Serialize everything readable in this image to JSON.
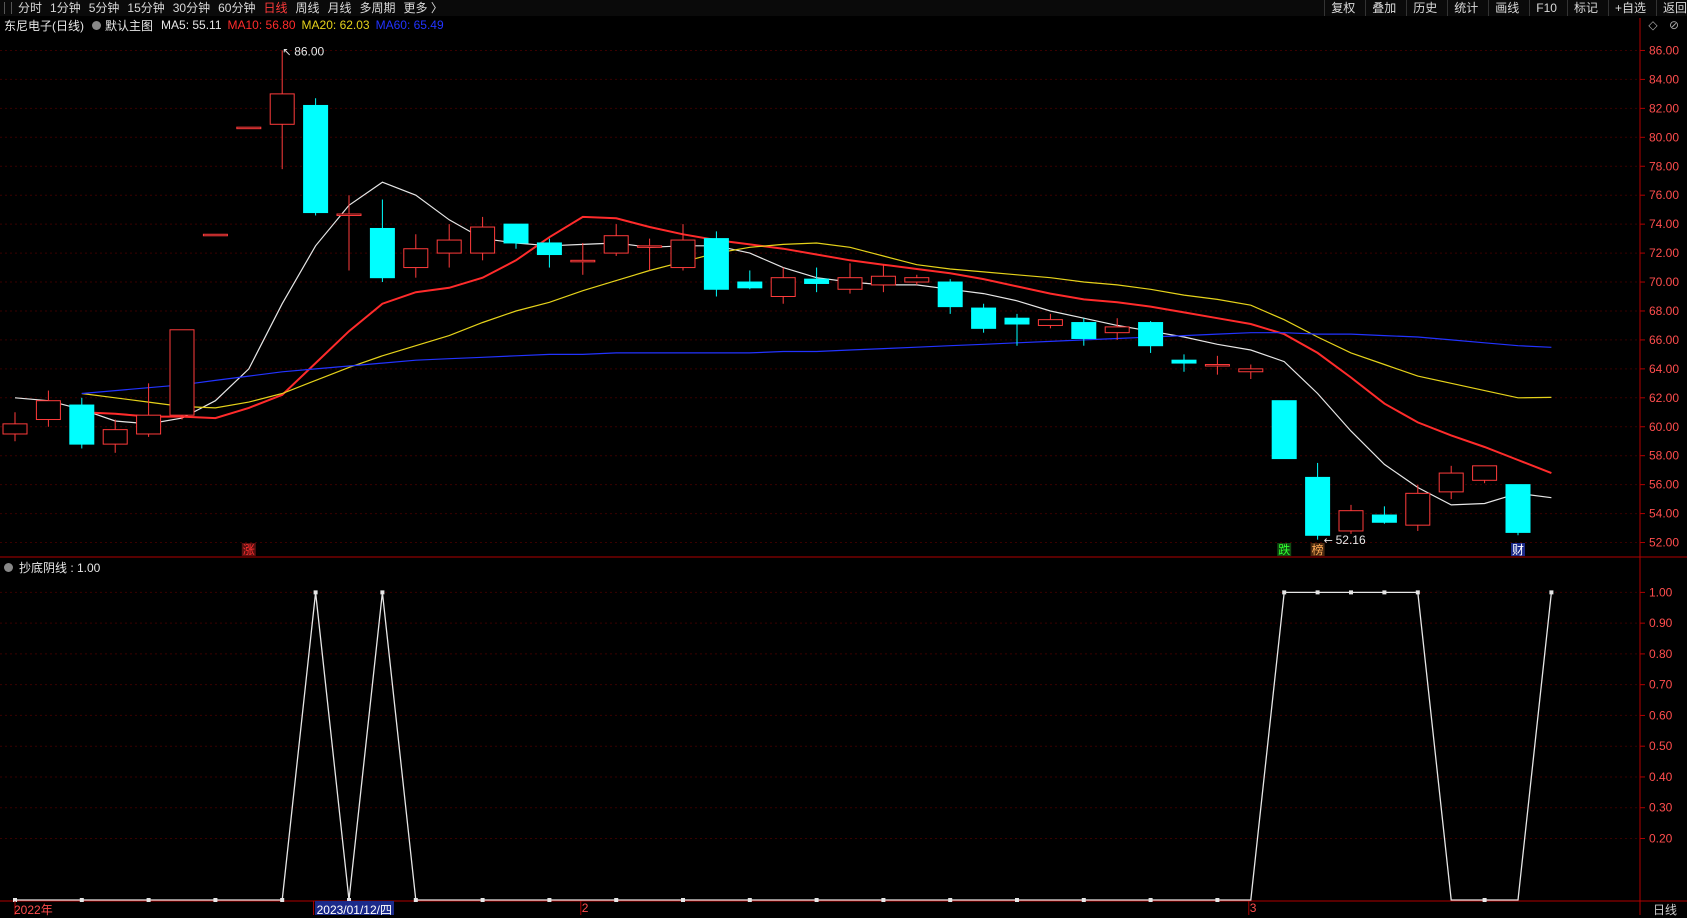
{
  "toolbar": {
    "periods": [
      "分时",
      "1分钟",
      "5分钟",
      "15分钟",
      "30分钟",
      "60分钟",
      "日线",
      "周线",
      "月线",
      "多周期",
      "更多 〉"
    ],
    "active_index": 6,
    "right": [
      "复权",
      "叠加",
      "历史",
      "统计",
      "画线",
      "F10",
      "标记",
      "+自选",
      "返回"
    ]
  },
  "main_legend": {
    "ticker": "东尼电子(日线)",
    "chart_name": "默认主图",
    "ma": [
      {
        "label": "MA5: 55.11",
        "color": "#e6e6e6"
      },
      {
        "label": "MA10: 56.80",
        "color": "#ff2b2b"
      },
      {
        "label": "MA20: 62.03",
        "color": "#e5d21a"
      },
      {
        "label": "MA60: 65.49",
        "color": "#2233ff"
      }
    ]
  },
  "corner_icons": "◇ ⊘",
  "annotations": {
    "high": "86.00",
    "low": "52.16",
    "low_arrow": "←",
    "high_arrow": "↖"
  },
  "markers": [
    {
      "text": "涨",
      "color": "#ff3030",
      "bg": "#5a1010",
      "idx": 7
    },
    {
      "text": "跌",
      "color": "#30ff30",
      "bg": "#104a10",
      "idx": 38
    },
    {
      "text": "榜",
      "color": "#ffaa55",
      "bg": "#4a2a10",
      "idx": 39
    },
    {
      "text": "财",
      "color": "#ffffff",
      "bg": "#1b2a8a",
      "idx": 45
    }
  ],
  "indicator_legend": "抄底阴线 : 1.00",
  "day_label": "日线",
  "dates": [
    {
      "text": "2022年",
      "idx": 0,
      "selected": false
    },
    {
      "text": "2023/01/12/四",
      "idx": 9,
      "selected": true
    },
    {
      "text": "2",
      "idx": 17,
      "selected": false
    },
    {
      "text": "3",
      "idx": 37,
      "selected": false
    }
  ],
  "chart_data": [
    {
      "type": "candlestick",
      "title": "东尼电子(日线)",
      "ylim": [
        51,
        87
      ],
      "y_ticks": [
        "86.00",
        "84.00",
        "82.00",
        "80.00",
        "78.00",
        "76.00",
        "74.00",
        "72.00",
        "70.00",
        "68.00",
        "66.00",
        "64.00",
        "62.00",
        "60.00",
        "58.00",
        "56.00",
        "54.00",
        "52.00"
      ],
      "candles": [
        {
          "o": 59.5,
          "c": 60.2,
          "h": 61.0,
          "l": 59.0
        },
        {
          "o": 60.5,
          "c": 61.8,
          "h": 62.5,
          "l": 60.0
        },
        {
          "o": 61.5,
          "c": 58.8,
          "h": 62.0,
          "l": 58.5
        },
        {
          "o": 58.8,
          "c": 59.8,
          "h": 60.5,
          "l": 58.2
        },
        {
          "o": 59.5,
          "c": 60.8,
          "h": 63.0,
          "l": 59.3
        },
        {
          "o": 60.8,
          "c": 66.7,
          "h": 66.7,
          "l": 60.5
        },
        {
          "o": 73.3,
          "c": 73.3,
          "h": 73.3,
          "l": 73.3
        },
        {
          "o": 80.7,
          "c": 80.7,
          "h": 80.7,
          "l": 80.7
        },
        {
          "o": 80.9,
          "c": 83.0,
          "h": 86.0,
          "l": 77.8
        },
        {
          "o": 82.2,
          "c": 74.8,
          "h": 82.7,
          "l": 74.6
        },
        {
          "o": 74.7,
          "c": 74.7,
          "h": 76.0,
          "l": 70.8
        },
        {
          "o": 73.7,
          "c": 70.3,
          "h": 75.7,
          "l": 70.0
        },
        {
          "o": 71.0,
          "c": 72.3,
          "h": 73.3,
          "l": 70.3
        },
        {
          "o": 72.0,
          "c": 72.9,
          "h": 74.0,
          "l": 71.0
        },
        {
          "o": 72.0,
          "c": 73.8,
          "h": 74.5,
          "l": 71.5
        },
        {
          "o": 74.0,
          "c": 72.7,
          "h": 74.0,
          "l": 72.3
        },
        {
          "o": 72.7,
          "c": 71.9,
          "h": 73.0,
          "l": 71.0
        },
        {
          "o": 71.5,
          "c": 71.5,
          "h": 72.7,
          "l": 70.5
        },
        {
          "o": 72.0,
          "c": 73.2,
          "h": 74.0,
          "l": 71.8
        },
        {
          "o": 72.5,
          "c": 72.5,
          "h": 73.0,
          "l": 70.8
        },
        {
          "o": 71.0,
          "c": 72.9,
          "h": 74.0,
          "l": 70.8
        },
        {
          "o": 73.0,
          "c": 69.5,
          "h": 73.5,
          "l": 69.0
        },
        {
          "o": 70.0,
          "c": 69.6,
          "h": 70.8,
          "l": 69.5
        },
        {
          "o": 69.0,
          "c": 70.3,
          "h": 71.0,
          "l": 68.5
        },
        {
          "o": 70.2,
          "c": 69.9,
          "h": 71.0,
          "l": 69.3
        },
        {
          "o": 69.5,
          "c": 70.3,
          "h": 71.3,
          "l": 69.2
        },
        {
          "o": 69.8,
          "c": 70.4,
          "h": 71.2,
          "l": 69.3
        },
        {
          "o": 70.0,
          "c": 70.3,
          "h": 70.5,
          "l": 69.8
        },
        {
          "o": 70.0,
          "c": 68.3,
          "h": 70.2,
          "l": 67.8
        },
        {
          "o": 68.2,
          "c": 66.8,
          "h": 68.5,
          "l": 66.5
        },
        {
          "o": 67.5,
          "c": 67.1,
          "h": 67.8,
          "l": 65.6
        },
        {
          "o": 67.0,
          "c": 67.4,
          "h": 67.8,
          "l": 66.8
        },
        {
          "o": 67.2,
          "c": 66.1,
          "h": 67.5,
          "l": 65.6
        },
        {
          "o": 66.5,
          "c": 66.9,
          "h": 67.5,
          "l": 66.0
        },
        {
          "o": 67.2,
          "c": 65.6,
          "h": 67.3,
          "l": 65.1
        },
        {
          "o": 64.6,
          "c": 64.4,
          "h": 65.0,
          "l": 63.8
        },
        {
          "o": 64.2,
          "c": 64.3,
          "h": 64.9,
          "l": 63.6
        },
        {
          "o": 63.8,
          "c": 64.0,
          "h": 64.3,
          "l": 63.3
        },
        {
          "o": 61.8,
          "c": 57.8,
          "h": 61.8,
          "l": 57.8
        },
        {
          "o": 56.5,
          "c": 52.5,
          "h": 57.5,
          "l": 52.2
        },
        {
          "o": 52.8,
          "c": 54.2,
          "h": 54.6,
          "l": 52.6
        },
        {
          "o": 53.9,
          "c": 53.4,
          "h": 54.5,
          "l": 53.3
        },
        {
          "o": 53.2,
          "c": 55.4,
          "h": 56.0,
          "l": 52.8
        },
        {
          "o": 55.5,
          "c": 56.8,
          "h": 57.3,
          "l": 55.0
        },
        {
          "o": 56.3,
          "c": 57.3,
          "h": 57.3,
          "l": 56.1
        },
        {
          "o": 56.0,
          "c": 52.7,
          "h": 56.0,
          "l": 52.5
        }
      ],
      "series": [
        {
          "name": "MA5",
          "color": "#e6e6e6",
          "values": [
            62.0,
            61.8,
            61.2,
            60.4,
            60.2,
            60.6,
            61.8,
            64.0,
            68.5,
            72.5,
            75.3,
            76.9,
            76.0,
            74.3,
            73.0,
            72.7,
            72.5,
            72.6,
            72.7,
            72.4,
            72.5,
            72.5,
            72.0,
            71.0,
            70.3,
            70.0,
            69.8,
            69.8,
            69.5,
            69.2,
            68.7,
            68.0,
            67.5,
            67.0,
            66.6,
            66.2,
            65.7,
            65.3,
            64.5,
            62.3,
            59.7,
            57.4,
            55.8,
            54.6,
            54.7,
            55.4,
            55.1
          ]
        },
        {
          "name": "MA10",
          "color": "#ff2b2b",
          "values": [
            null,
            null,
            61.0,
            60.9,
            60.7,
            60.7,
            60.6,
            61.3,
            62.2,
            64.4,
            66.6,
            68.5,
            69.3,
            69.6,
            70.3,
            71.5,
            73.1,
            74.5,
            74.4,
            73.8,
            73.3,
            72.9,
            72.6,
            72.3,
            71.9,
            71.5,
            71.2,
            70.9,
            70.6,
            70.2,
            69.7,
            69.2,
            68.8,
            68.6,
            68.3,
            67.9,
            67.5,
            67.1,
            66.4,
            65.1,
            63.4,
            61.6,
            60.3,
            59.4,
            58.6,
            57.7,
            56.8
          ]
        },
        {
          "name": "MA20",
          "color": "#e5d21a",
          "values": [
            null,
            null,
            62.3,
            62.0,
            61.7,
            61.4,
            61.3,
            61.7,
            62.3,
            63.2,
            64.1,
            64.9,
            65.6,
            66.3,
            67.2,
            68.0,
            68.6,
            69.4,
            70.1,
            70.8,
            71.4,
            72.0,
            72.4,
            72.6,
            72.7,
            72.4,
            71.8,
            71.2,
            70.9,
            70.7,
            70.5,
            70.3,
            70.0,
            69.8,
            69.5,
            69.1,
            68.8,
            68.4,
            67.4,
            66.2,
            65.1,
            64.3,
            63.5,
            63.0,
            62.5,
            62.0,
            62.03
          ]
        },
        {
          "name": "MA60",
          "color": "#2233ff",
          "values": [
            null,
            null,
            62.3,
            62.5,
            62.7,
            62.9,
            63.2,
            63.5,
            63.8,
            64.0,
            64.2,
            64.4,
            64.6,
            64.7,
            64.8,
            64.9,
            65.0,
            65.0,
            65.1,
            65.1,
            65.1,
            65.1,
            65.1,
            65.2,
            65.2,
            65.3,
            65.4,
            65.5,
            65.6,
            65.7,
            65.8,
            65.9,
            66.0,
            66.1,
            66.2,
            66.3,
            66.4,
            66.5,
            66.5,
            66.4,
            66.4,
            66.3,
            66.2,
            66.0,
            65.8,
            65.6,
            65.49
          ]
        }
      ]
    },
    {
      "type": "line",
      "title": "抄底阴线",
      "ylim": [
        0,
        1.05
      ],
      "y_ticks": [
        "1.00",
        "0.90",
        "0.80",
        "0.70",
        "0.60",
        "0.50",
        "0.40",
        "0.30",
        "0.20"
      ],
      "series": [
        {
          "name": "抄底阴线",
          "color": "#e6e6e6",
          "values": [
            0,
            0,
            0,
            0,
            0,
            0,
            0,
            0,
            0,
            1,
            0,
            1,
            0,
            0,
            0,
            0,
            0,
            0,
            0,
            0,
            0,
            0,
            0,
            0,
            0,
            0,
            0,
            0,
            0,
            0,
            0,
            0,
            0,
            0,
            0,
            0,
            0,
            0,
            1,
            1,
            1,
            1,
            1,
            0,
            0,
            0,
            1
          ]
        }
      ]
    }
  ]
}
